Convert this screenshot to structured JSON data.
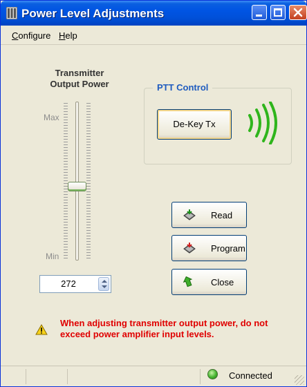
{
  "window": {
    "title": "Power Level Adjustments",
    "icon": "app-grid-icon",
    "controls": [
      "minimize-icon",
      "maximize-icon",
      "close-icon"
    ]
  },
  "menu": {
    "configure": {
      "mnemonic": "C",
      "rest": "onfigure"
    },
    "help": {
      "mnemonic": "H",
      "rest": "elp"
    }
  },
  "slider": {
    "title_line1": "Transmitter",
    "title_line2": "Output Power",
    "max_label": "Max",
    "min_label": "Min",
    "level_fraction": 0.45
  },
  "spin": {
    "value": "272"
  },
  "ptt": {
    "group_label": "PTT Control",
    "dekey_label": "De-Key Tx",
    "wave_icon": "transmit-waves-icon",
    "wave_color": "#2fb51c"
  },
  "actions": {
    "read": {
      "label": "Read",
      "icon": "chip-read-icon"
    },
    "program": {
      "label": "Program",
      "icon": "chip-program-icon"
    },
    "close": {
      "label": "Close",
      "icon": "exit-arrow-icon"
    }
  },
  "warning": {
    "text": "When adjusting transmitter output power, do not exceed power amplifier input levels.",
    "color": "#e00000",
    "icon": "warning-triangle-icon"
  },
  "status": {
    "connection": "Connected",
    "led_color": "#46b52f"
  }
}
